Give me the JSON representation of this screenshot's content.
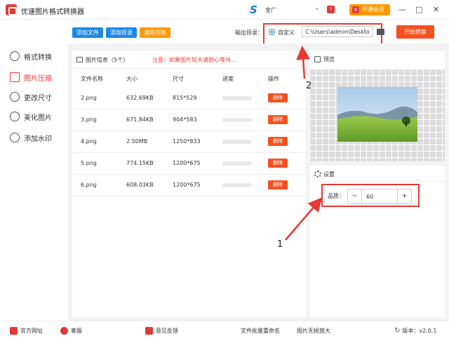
{
  "app": {
    "title": "优速图片格式转换器"
  },
  "topbar": {
    "user_name": "金厂",
    "user_dropdown": "⌄",
    "vip_label": "开通会员",
    "minimize": "—",
    "maximize": "□",
    "close": "✕"
  },
  "sidebar": {
    "items": [
      {
        "label": "格式转换",
        "icon": "format-convert-icon"
      },
      {
        "label": "图片压缩",
        "icon": "compress-icon",
        "active": true
      },
      {
        "label": "更改尺寸",
        "icon": "resize-icon"
      },
      {
        "label": "美化图片",
        "icon": "beautify-icon"
      },
      {
        "label": "添加水印",
        "icon": "watermark-icon"
      }
    ]
  },
  "toolbar": {
    "add_file": "添加文件",
    "add_dir": "添加目录",
    "clear_list": "清除列表",
    "output_label": "输出目录：",
    "custom_label": "自定义",
    "output_path": "C:\\Users\\admin\\Deskto",
    "start_button": "开始转换"
  },
  "list": {
    "info_label": "图片信息（5个）",
    "note": "注意：如果图片较大请耐心等待...",
    "columns": [
      "文件名称",
      "大小",
      "尺寸",
      "进度",
      "操作"
    ],
    "delete_label": "删除",
    "rows": [
      {
        "name": "2.png",
        "size": "632.69KB",
        "dims": "815*529",
        "progress": 0
      },
      {
        "name": "3.png",
        "size": "671.84KB",
        "dims": "904*583",
        "progress": 0
      },
      {
        "name": "4.png",
        "size": "2.50MB",
        "dims": "1250*833",
        "progress": 0
      },
      {
        "name": "5.png",
        "size": "774.15KB",
        "dims": "1200*675",
        "progress": 0
      },
      {
        "name": "6.png",
        "size": "608.03KB",
        "dims": "1200*675",
        "progress": 0
      }
    ]
  },
  "preview": {
    "label": "预览"
  },
  "settings": {
    "label": "设置",
    "quality_label": "品质：",
    "quality_value": "60",
    "minus": "−",
    "plus": "+"
  },
  "annotations": {
    "one": "1",
    "two": "2"
  },
  "footer": {
    "website": "官方网址",
    "service": "客服",
    "feedback": "意见反馈",
    "batch_rename": "文件批量重命名",
    "lossless": "图片无损放大",
    "version": "版本：v2.0.1"
  },
  "colors": {
    "accent_red": "#e53935",
    "add_file_blue": "#1e88e5",
    "clear_orange": "#ff9800",
    "start_orange": "#f4511e"
  }
}
